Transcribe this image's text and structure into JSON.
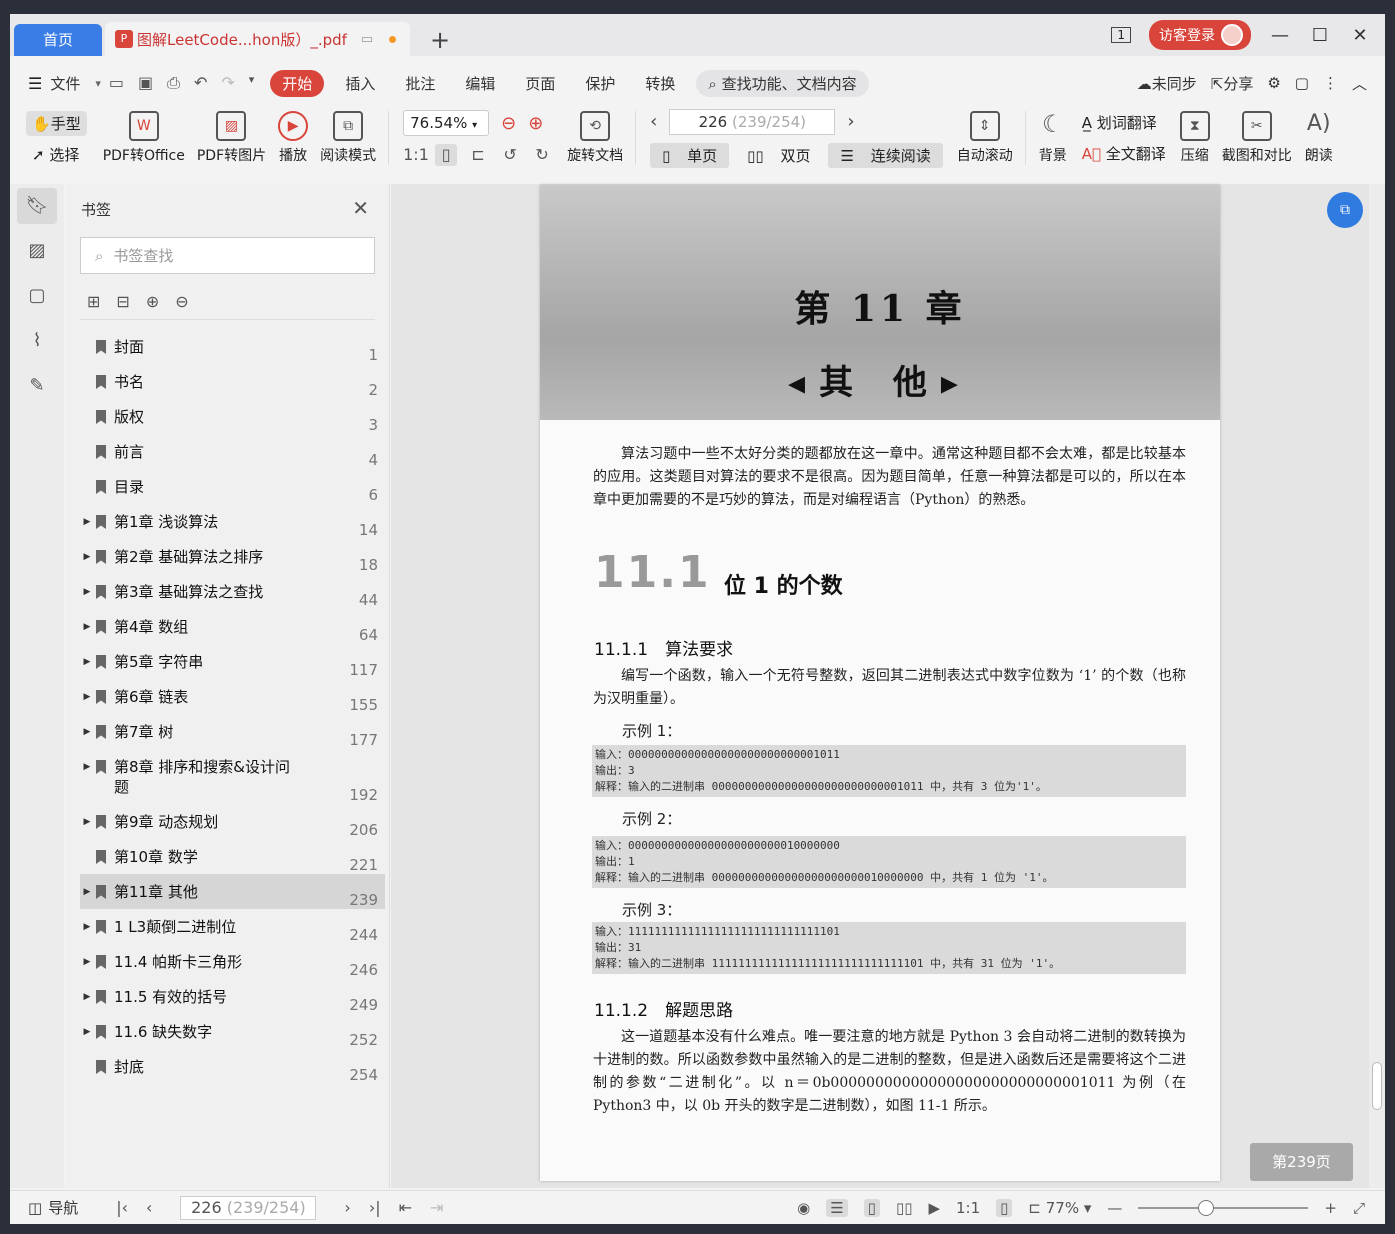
{
  "titlebar": {
    "home_tab": "首页",
    "doc_tab": "图解LeetCode...hon版）_.pdf",
    "page_indicator": "1",
    "login": "访客登录"
  },
  "menubar": {
    "file": "文件",
    "items": [
      "开始",
      "插入",
      "批注",
      "编辑",
      "页面",
      "保护",
      "转换"
    ],
    "search": "查找功能、文档内容",
    "sync": "未同步",
    "share": "分享"
  },
  "toolbar": {
    "hand": "手型",
    "select": "选择",
    "pdf_office": "PDF转Office",
    "pdf_image": "PDF转图片",
    "play": "播放",
    "read_mode": "阅读模式",
    "zoom": "76.54%",
    "rotate": "旋转文档",
    "page_box": "226",
    "page_box_extra": "(239/254)",
    "single": "单页",
    "double": "双页",
    "continuous": "连续阅读",
    "auto_scroll": "自动滚动",
    "background": "背景",
    "word_translate": "划词翻译",
    "full_translate": "全文翻译",
    "compress": "压缩",
    "screenshot": "截图和对比",
    "read_aloud": "朗读"
  },
  "panel": {
    "title": "书签",
    "search_placeholder": "书签查找",
    "bookmarks": [
      {
        "label": "封面",
        "page": "1",
        "arrow": ""
      },
      {
        "label": "书名",
        "page": "2",
        "arrow": ""
      },
      {
        "label": "版权",
        "page": "3",
        "arrow": ""
      },
      {
        "label": "前言",
        "page": "4",
        "arrow": ""
      },
      {
        "label": "目录",
        "page": "6",
        "arrow": ""
      },
      {
        "label": "第1章 浅谈算法",
        "page": "14",
        "arrow": "▶"
      },
      {
        "label": "第2章 基础算法之排序",
        "page": "18",
        "arrow": "▶"
      },
      {
        "label": "第3章 基础算法之查找",
        "page": "44",
        "arrow": "▶"
      },
      {
        "label": "第4章 数组",
        "page": "64",
        "arrow": "▶"
      },
      {
        "label": "第5章 字符串",
        "page": "117",
        "arrow": "▶"
      },
      {
        "label": "第6章 链表",
        "page": "155",
        "arrow": "▶"
      },
      {
        "label": "第7章 树",
        "page": "177",
        "arrow": "▶"
      },
      {
        "label": "第8章 排序和搜索&设计问题",
        "page": "192",
        "arrow": "▶"
      },
      {
        "label": "第9章 动态规划",
        "page": "206",
        "arrow": "▶"
      },
      {
        "label": "第10章 数学",
        "page": "221",
        "arrow": ""
      },
      {
        "label": "第11章 其他",
        "page": "239",
        "arrow": "▶"
      },
      {
        "label": "1 L3颠倒二进制位",
        "page": "244",
        "arrow": "▶"
      },
      {
        "label": "11.4 帕斯卡三角形",
        "page": "246",
        "arrow": "▶"
      },
      {
        "label": "11.5 有效的括号",
        "page": "249",
        "arrow": "▶"
      },
      {
        "label": "11.6 缺失数字",
        "page": "252",
        "arrow": "▶"
      },
      {
        "label": "封底",
        "page": "254",
        "arrow": ""
      }
    ]
  },
  "doc": {
    "chapter": "第 11 章",
    "chapter_sub": "◂其 他▸",
    "intro": "算法习题中一些不太好分类的题都放在这一章中。通常这种题目都不会太难，都是比较基本的应用。这类题目对算法的要求不是很高。因为题目简单，任意一种算法都是可以的，所以在本章中更加需要的不是巧妙的算法，而是对编程语言（Python）的熟悉。",
    "sec_num": "11.1",
    "sec_title": "位 1 的个数",
    "sub1": "11.1.1　算法要求",
    "req": "编写一个函数，输入一个无符号整数，返回其二进制表达式中数字位数为 ‘1’ 的个数（也称为汉明重量）。",
    "ex1": "示例 1：",
    "ex1_in": "输入：00000000000000000000000000001011",
    "ex1_out": "输出：3",
    "ex1_exp": "解释：输入的二进制串 00000000000000000000000000001011 中，共有 3 位为'1'。",
    "ex2": "示例 2：",
    "ex2_in": "输入：00000000000000000000000010000000",
    "ex2_out": "输出：1",
    "ex2_exp": "解释：输入的二进制串 00000000000000000000000010000000 中，共有 1 位为 '1'。",
    "ex3": "示例 3：",
    "ex3_in": "输入：11111111111111111111111111111101",
    "ex3_out": "输出：31",
    "ex3_exp": "解释：输入的二进制串 11111111111111111111111111111101 中，共有 31 位为 '1'。",
    "sub2": "11.1.2　解题思路",
    "idea": "这一道题基本没有什么难点。唯一要注意的地方就是 Python 3 会自动将二进制的数转换为十进制的数。所以函数参数中虽然输入的是二进制的整数，但是进入函数后还是需要将这个二进制的参数“二进制化”。以 n＝0b00000000000000000000000000001011 为例（在 Python3 中，以 0b 开头的数字是二进制数），如图 11-1 所示。",
    "page_badge": "第239页"
  },
  "statusbar": {
    "nav": "导航",
    "page_box": "226",
    "page_box_extra": "(239/254)",
    "zoom": "77%"
  },
  "colors": {
    "accent": "#d9443b",
    "blue": "#3b7de6"
  }
}
